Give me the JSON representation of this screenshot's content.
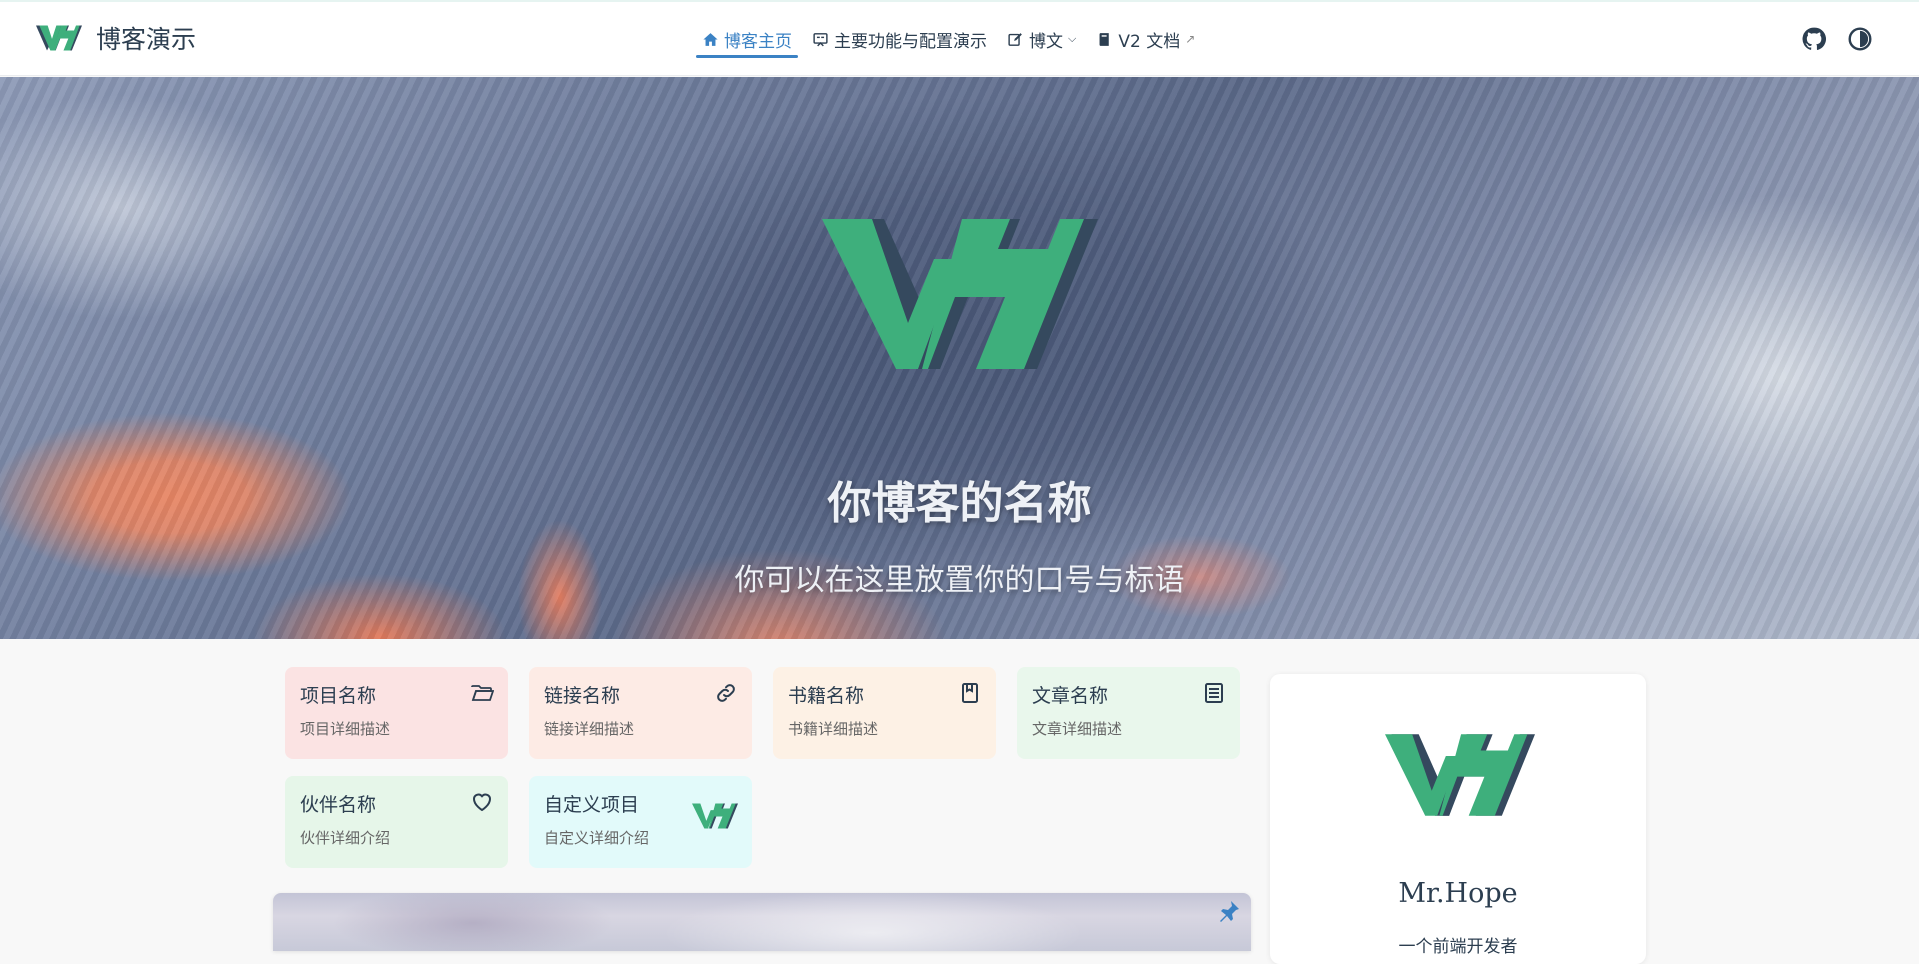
{
  "brand": {
    "name": "博客演示"
  },
  "nav": {
    "items": [
      {
        "label": "博客主页",
        "icon": "home-icon",
        "active": true
      },
      {
        "label": "主要功能与配置演示",
        "icon": "slides-icon"
      },
      {
        "label": "博文",
        "icon": "edit-icon",
        "dropdown": true
      },
      {
        "label": "V2 文档",
        "icon": "book-icon",
        "external": true
      }
    ],
    "right_icons": [
      "github-icon",
      "theme-toggle-icon"
    ]
  },
  "hero": {
    "title": "你博客的名称",
    "tagline": "你可以在这里放置你的口号与标语"
  },
  "cards": [
    {
      "title": "项目名称",
      "desc": "项目详细描述",
      "icon": "folder-icon",
      "color": "#fbe3e3"
    },
    {
      "title": "链接名称",
      "desc": "链接详细描述",
      "icon": "link-icon",
      "color": "#fdebe5"
    },
    {
      "title": "书籍名称",
      "desc": "书籍详细描述",
      "icon": "book-icon",
      "color": "#fdf1e5"
    },
    {
      "title": "文章名称",
      "desc": "文章详细描述",
      "icon": "article-icon",
      "color": "#e9f7ec"
    },
    {
      "title": "伙伴名称",
      "desc": "伙伴详细介绍",
      "icon": "heart-icon",
      "color": "#e6f6e9"
    },
    {
      "title": "自定义项目",
      "desc": "自定义详细介绍",
      "icon": "vh-logo-icon",
      "color": "#e2fafa"
    }
  ],
  "profile": {
    "name": "Mr.Hope",
    "desc": "一个前端开发者"
  },
  "colors": {
    "accent": "#3b82c4",
    "logo_green": "#3eaf7c",
    "logo_dark": "#35495e"
  }
}
